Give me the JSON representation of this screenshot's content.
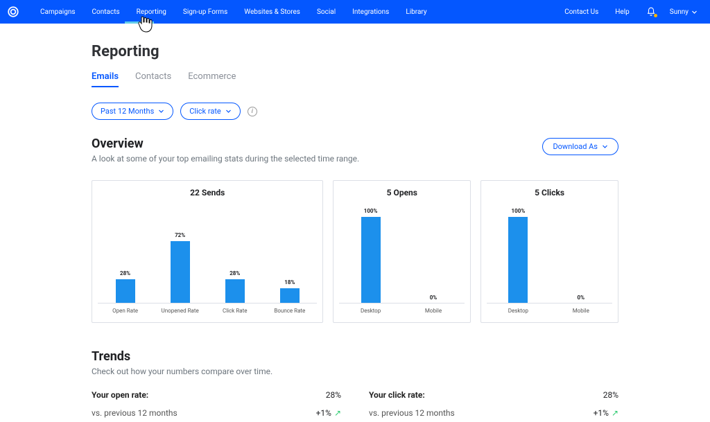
{
  "nav": {
    "items": [
      "Campaigns",
      "Contacts",
      "Reporting",
      "Sign-up Forms",
      "Websites & Stores",
      "Social",
      "Integrations",
      "Library"
    ],
    "right": {
      "contact": "Contact Us",
      "help": "Help",
      "user": "Sunny"
    }
  },
  "page": {
    "title": "Reporting",
    "tabs": [
      "Emails",
      "Contacts",
      "Ecommerce"
    ],
    "active_tab": 0,
    "filters": {
      "range": "Past 12 Months",
      "metric": "Click rate"
    },
    "overview": {
      "title": "Overview",
      "subtitle": "A look at some of your top emailing stats during the selected time range.",
      "download": "Download As"
    },
    "trends": {
      "title": "Trends",
      "subtitle": "Check out how your numbers compare over time.",
      "left": {
        "label": "Your open rate:",
        "headline": "28%",
        "compare_label": "vs. previous 12 months",
        "compare_val": "+1%"
      },
      "right": {
        "label": "Your click rate:",
        "headline": "28%",
        "compare_label": "vs. previous 12 months",
        "compare_val": "+1%"
      }
    }
  },
  "chart_data": [
    {
      "type": "bar",
      "title": "22 Sends",
      "categories": [
        "Open Rate",
        "Unopened Rate",
        "Click Rate",
        "Bounce Rate"
      ],
      "values": [
        28,
        72,
        28,
        18
      ],
      "ylim": [
        0,
        100
      ],
      "value_suffix": "%"
    },
    {
      "type": "bar",
      "title": "5 Opens",
      "categories": [
        "Desktop",
        "Mobile"
      ],
      "values": [
        100,
        0
      ],
      "ylim": [
        0,
        100
      ],
      "value_suffix": "%"
    },
    {
      "type": "bar",
      "title": "5 Clicks",
      "categories": [
        "Desktop",
        "Mobile"
      ],
      "values": [
        100,
        0
      ],
      "ylim": [
        0,
        100
      ],
      "value_suffix": "%"
    }
  ]
}
